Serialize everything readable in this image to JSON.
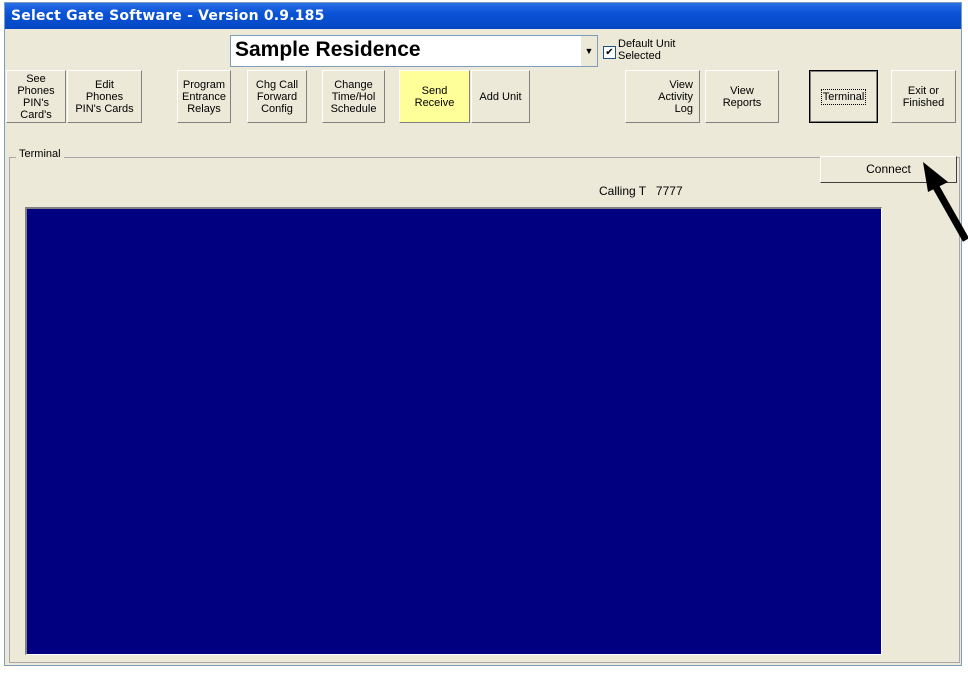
{
  "window": {
    "title": "Select Gate Software - Version 0.9.185"
  },
  "unit_select": {
    "value": "Sample Residence"
  },
  "default_unit": {
    "label": "Default Unit\nSelected",
    "checked": true
  },
  "toolbar": {
    "see_phones": "See\nPhones\nPIN's Card's",
    "edit_phones": "Edit\nPhones\nPIN's Cards",
    "program_relays": "Program\nEntrance\nRelays",
    "chg_call_forward": "Chg Call\nForward\nConfig",
    "change_schedule": "Change\nTime/Hol\nSchedule",
    "send_receive": "Send\nReceive",
    "add_unit": "Add Unit",
    "view_activity": "View\nActivity\nLog",
    "view_reports": "View\nReports",
    "terminal": "Terminal",
    "exit": "Exit or\nFinished"
  },
  "terminal_panel": {
    "group_label": "Terminal",
    "connect_label": "Connect",
    "calling_text": "Calling T   7777",
    "screen_color": "#000080"
  },
  "colors": {
    "highlight_button": "#ffff99",
    "titlebar": "#0a53d6"
  }
}
